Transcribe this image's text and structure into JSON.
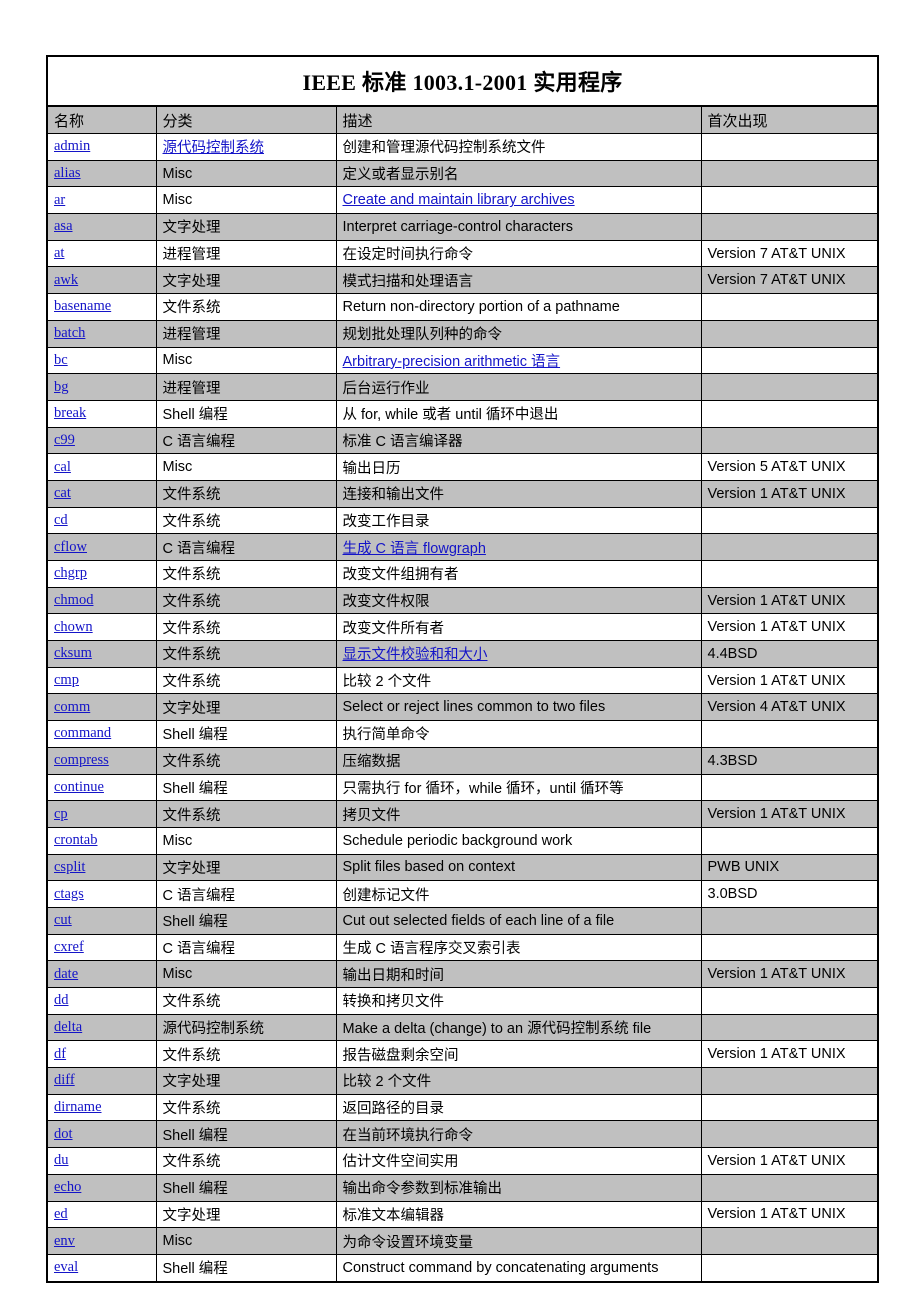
{
  "document": {
    "title": "IEEE 标准 1003.1-2001  实用程序",
    "link_color": "#1414c8",
    "shade_color": "#c0c0c0",
    "headers": {
      "name": "名称",
      "category": "分类",
      "description": "描述",
      "first_appeared": "首次出现"
    }
  },
  "rows": [
    {
      "name": "admin",
      "name_link": true,
      "category": "源代码控制系统",
      "category_link": true,
      "description": "创建和管理源代码控制系统文件",
      "description_link": false,
      "first": ""
    },
    {
      "name": "alias",
      "name_link": true,
      "category": "Misc",
      "category_link": false,
      "description": "定义或者显示别名",
      "description_link": false,
      "first": ""
    },
    {
      "name": "ar",
      "name_link": true,
      "category": "Misc",
      "category_link": false,
      "description": "Create and maintain library archives",
      "description_link": true,
      "first": ""
    },
    {
      "name": "asa",
      "name_link": true,
      "category": "文字处理",
      "category_link": false,
      "description": "Interpret carriage-control characters",
      "description_link": false,
      "first": ""
    },
    {
      "name": "at",
      "name_link": true,
      "category": "进程管理",
      "category_link": false,
      "description": "在设定时间执行命令",
      "description_link": false,
      "first": "Version 7 AT&T UNIX"
    },
    {
      "name": "awk",
      "name_link": true,
      "category": "文字处理",
      "category_link": false,
      "description": "模式扫描和处理语言",
      "description_link": false,
      "first": "Version 7 AT&T UNIX"
    },
    {
      "name": "basename",
      "name_link": true,
      "category": "文件系统",
      "category_link": false,
      "description": "Return non-directory portion of a pathname",
      "description_link": false,
      "first": ""
    },
    {
      "name": "batch",
      "name_link": true,
      "category": "进程管理",
      "category_link": false,
      "description": "规划批处理队列种的命令",
      "description_link": false,
      "first": ""
    },
    {
      "name": "bc",
      "name_link": true,
      "category": "Misc",
      "category_link": false,
      "description": "Arbitrary-precision arithmetic  语言",
      "description_link": true,
      "first": ""
    },
    {
      "name": "bg",
      "name_link": true,
      "category": "进程管理",
      "category_link": false,
      "description": "后台运行作业",
      "description_link": false,
      "first": ""
    },
    {
      "name": "break",
      "name_link": true,
      "category": "Shell 编程",
      "category_link": false,
      "description": "从 for, while 或者  until  循环中退出",
      "description_link": false,
      "first": ""
    },
    {
      "name": "c99",
      "name_link": true,
      "category": "C 语言编程",
      "category_link": false,
      "description": "标准 C 语言编译器",
      "description_link": false,
      "first": ""
    },
    {
      "name": "cal",
      "name_link": true,
      "category": "Misc",
      "category_link": false,
      "description": "输出日历",
      "description_link": false,
      "first": "Version 5 AT&T UNIX"
    },
    {
      "name": "cat",
      "name_link": true,
      "category": "文件系统",
      "category_link": false,
      "description": "连接和输出文件",
      "description_link": false,
      "first": "Version 1 AT&T UNIX"
    },
    {
      "name": "cd",
      "name_link": true,
      "category": "文件系统",
      "category_link": false,
      "description": "改变工作目录",
      "description_link": false,
      "first": ""
    },
    {
      "name": "cflow",
      "name_link": true,
      "category": "C 语言编程",
      "category_link": false,
      "description": "生成 C 语言  flowgraph",
      "description_link": true,
      "first": ""
    },
    {
      "name": "chgrp",
      "name_link": true,
      "category": "文件系统",
      "category_link": false,
      "description": "改变文件组拥有者",
      "description_link": false,
      "first": ""
    },
    {
      "name": "chmod",
      "name_link": true,
      "category": "文件系统",
      "category_link": false,
      "description": "改变文件权限",
      "description_link": false,
      "first": "Version 1 AT&T UNIX"
    },
    {
      "name": "chown",
      "name_link": true,
      "category": "文件系统",
      "category_link": false,
      "description": "改变文件所有者",
      "description_link": false,
      "first": "Version 1 AT&T UNIX"
    },
    {
      "name": "cksum",
      "name_link": true,
      "category": "文件系统",
      "category_link": false,
      "description": "显示文件校验和和大小",
      "description_link": true,
      "first": "4.4BSD"
    },
    {
      "name": "cmp",
      "name_link": true,
      "category": "文件系统",
      "category_link": false,
      "description": "比较 2 个文件",
      "description_link": false,
      "first": "Version 1 AT&T UNIX"
    },
    {
      "name": "comm",
      "name_link": true,
      "category": "文字处理",
      "category_link": false,
      "description": "Select or reject lines common to two files",
      "description_link": false,
      "first": "Version 4 AT&T UNIX"
    },
    {
      "name": "command",
      "name_link": true,
      "category": "Shell 编程",
      "category_link": false,
      "description": "执行简单命令",
      "description_link": false,
      "first": ""
    },
    {
      "name": "compress",
      "name_link": true,
      "category": "文件系统",
      "category_link": false,
      "description": "压缩数据",
      "description_link": false,
      "first": "4.3BSD"
    },
    {
      "name": "continue",
      "name_link": true,
      "category": "Shell 编程",
      "category_link": false,
      "description": "只需执行 for 循环，while 循环，until 循环等",
      "description_link": false,
      "first": ""
    },
    {
      "name": "cp",
      "name_link": true,
      "category": "文件系统",
      "category_link": false,
      "description": "拷贝文件",
      "description_link": false,
      "first": "Version 1 AT&T UNIX"
    },
    {
      "name": "crontab",
      "name_link": true,
      "category": "Misc",
      "category_link": false,
      "description": "Schedule periodic background work",
      "description_link": false,
      "first": ""
    },
    {
      "name": "csplit",
      "name_link": true,
      "category": "文字处理",
      "category_link": false,
      "description": "Split files based on context",
      "description_link": false,
      "first": "PWB UNIX"
    },
    {
      "name": "ctags",
      "name_link": true,
      "category": "C 语言编程",
      "category_link": false,
      "description": "创建标记文件",
      "description_link": false,
      "first": "3.0BSD"
    },
    {
      "name": "cut",
      "name_link": true,
      "category": "Shell 编程",
      "category_link": false,
      "description": "Cut out selected fields of each line of a file",
      "description_link": false,
      "first": ""
    },
    {
      "name": "cxref",
      "name_link": true,
      "category": "C 语言编程",
      "category_link": false,
      "description": "生成 C 语言程序交叉索引表",
      "description_link": false,
      "first": ""
    },
    {
      "name": "date",
      "name_link": true,
      "category": "Misc",
      "category_link": false,
      "description": "输出日期和时间",
      "description_link": false,
      "first": "Version 1 AT&T UNIX"
    },
    {
      "name": "dd",
      "name_link": true,
      "category": "文件系统",
      "category_link": false,
      "description": "转换和拷贝文件",
      "description_link": false,
      "first": ""
    },
    {
      "name": "delta",
      "name_link": true,
      "category": "源代码控制系统",
      "category_link": false,
      "description": "Make a delta (change) to an  源代码控制系统  file",
      "description_link": false,
      "first": ""
    },
    {
      "name": "df",
      "name_link": true,
      "category": "文件系统",
      "category_link": false,
      "description": "报告磁盘剩余空间",
      "description_link": false,
      "first": "Version 1 AT&T UNIX"
    },
    {
      "name": "diff",
      "name_link": true,
      "category": "文字处理",
      "category_link": false,
      "description": "比较 2 个文件",
      "description_link": false,
      "first": ""
    },
    {
      "name": "dirname",
      "name_link": true,
      "category": "文件系统",
      "category_link": false,
      "description": "返回路径的目录",
      "description_link": false,
      "first": ""
    },
    {
      "name": "dot",
      "name_link": true,
      "category": "Shell 编程",
      "category_link": false,
      "description": "在当前环境执行命令",
      "description_link": false,
      "first": ""
    },
    {
      "name": "du",
      "name_link": true,
      "category": "文件系统",
      "category_link": false,
      "description": "估计文件空间实用",
      "description_link": false,
      "first": "Version 1 AT&T UNIX"
    },
    {
      "name": "echo",
      "name_link": true,
      "category": "Shell 编程",
      "category_link": false,
      "description": "输出命令参数到标准输出",
      "description_link": false,
      "first": ""
    },
    {
      "name": "ed",
      "name_link": true,
      "category": "文字处理",
      "category_link": false,
      "description": "标准文本编辑器",
      "description_link": false,
      "first": "Version 1 AT&T UNIX"
    },
    {
      "name": "env",
      "name_link": true,
      "category": "Misc",
      "category_link": false,
      "description": "为命令设置环境变量",
      "description_link": false,
      "first": ""
    },
    {
      "name": "eval",
      "name_link": true,
      "category": "Shell 编程",
      "category_link": false,
      "description": "Construct command by concatenating arguments",
      "description_link": false,
      "first": ""
    }
  ]
}
